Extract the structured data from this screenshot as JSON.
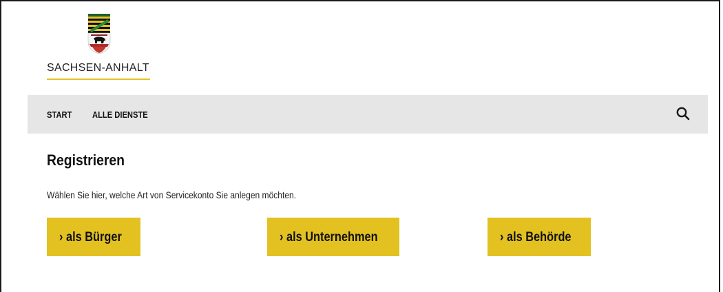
{
  "logo": {
    "wordmark": "SACHSEN-ANHALT",
    "icon": "coat-of-arms-icon",
    "accent_color": "#e3c326"
  },
  "nav": {
    "items": [
      {
        "label": "START"
      },
      {
        "label": "ALLE DIENSTE"
      }
    ],
    "search_icon": "search-icon",
    "background": "#e6e6e6"
  },
  "main": {
    "title": "Registrieren",
    "intro": "Wählen Sie hier, welche Art von Servicekonto Sie anlegen möchten.",
    "buttons": [
      {
        "label": "› als Bürger"
      },
      {
        "label": "› als Unternehmen"
      },
      {
        "label": "› als Behörde"
      }
    ],
    "button_color": "#e3c121"
  }
}
